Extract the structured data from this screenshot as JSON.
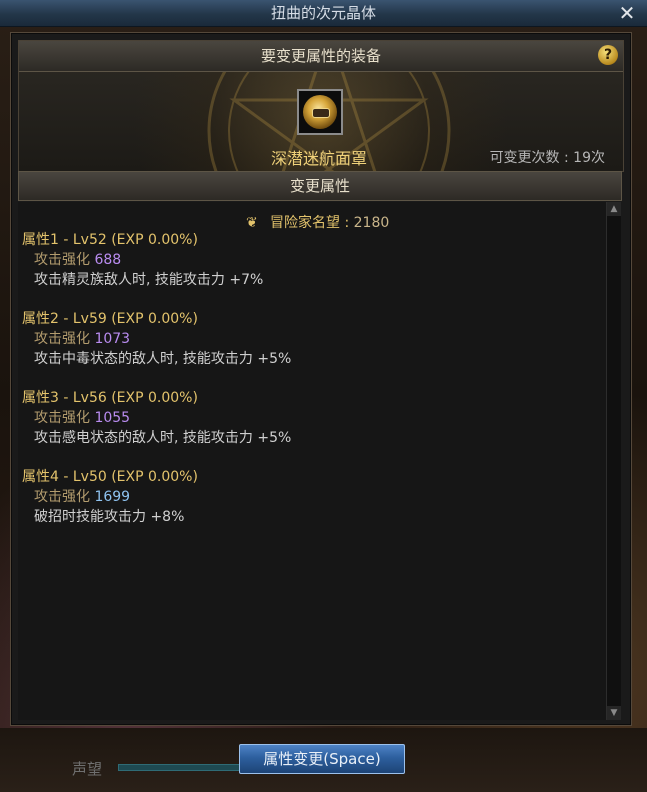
{
  "window": {
    "title": "扭曲的次元晶体",
    "close_glyph": "✕"
  },
  "equip_section": {
    "header": "要变更属性的装备",
    "help_glyph": "?",
    "item_name": "深潜迷航面罩",
    "change_count": "可变更次数 : 19次"
  },
  "attr_section": {
    "header": "变更属性",
    "fame_label": "冒险家名望 :",
    "fame_value": "2180",
    "fame_icon": "laurel-icon",
    "attributes": [
      {
        "title": "属性1 - Lv52 (EXP 0.00%)",
        "stat_label": "攻击强化",
        "stat_value": "688",
        "stat_color": "#b98cf0",
        "effect": "攻击精灵族敌人时, 技能攻击力 +7%"
      },
      {
        "title": "属性2 - Lv59 (EXP 0.00%)",
        "stat_label": "攻击强化",
        "stat_value": "1073",
        "stat_color": "#b98cf0",
        "effect": "攻击中毒状态的敌人时, 技能攻击力 +5%"
      },
      {
        "title": "属性3 - Lv56 (EXP 0.00%)",
        "stat_label": "攻击强化",
        "stat_value": "1055",
        "stat_color": "#b98cf0",
        "effect": "攻击感电状态的敌人时, 技能攻击力 +5%"
      },
      {
        "title": "属性4 - Lv50 (EXP 0.00%)",
        "stat_label": "攻击强化",
        "stat_value": "1699",
        "stat_color": "#8fc3f0",
        "effect": "破招时技能攻击力 +8%"
      }
    ]
  },
  "bottom": {
    "rep_label": "声望",
    "change_button": "属性变更(Space)"
  },
  "colors": {
    "accent_gold": "#e3c36c",
    "button_blue": "#2d5f9e"
  }
}
